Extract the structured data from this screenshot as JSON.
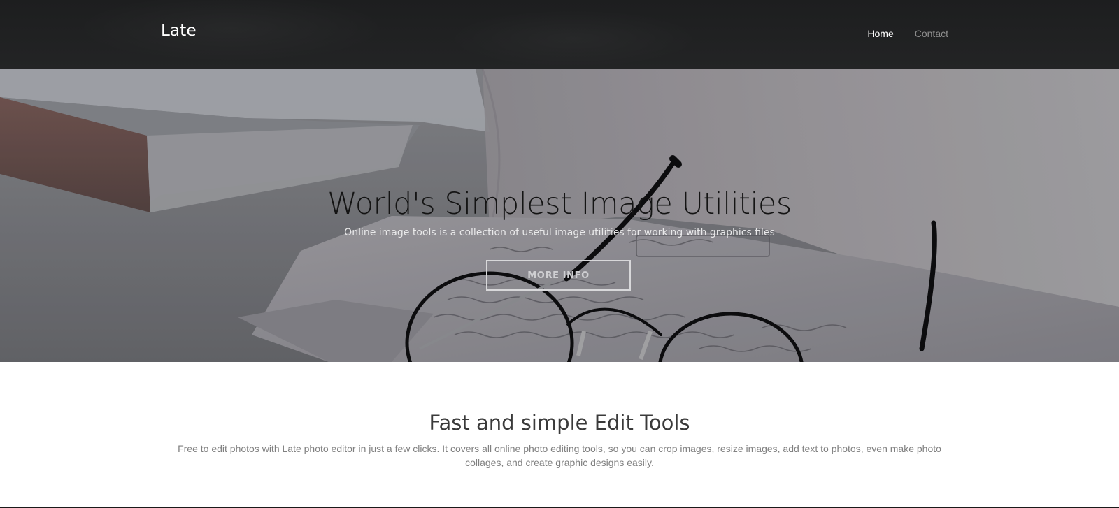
{
  "navbar": {
    "brand": "Late",
    "links": [
      {
        "label": "Home",
        "active": true
      },
      {
        "label": "Contact",
        "active": false
      }
    ]
  },
  "hero": {
    "title": "World's Simplest Image Utilities",
    "subtitle": "Online image tools is a collection of useful image utilities for working with graphics files",
    "button_label": "MORE INFO",
    "background_description_icon": "photo-glasses-notebook"
  },
  "features": {
    "title": "Fast and simple Edit Tools",
    "text": "Free to edit photos with Late photo editor in just a few clicks. It covers all online photo editing tools, so you can crop images, resize images, add text to photos, even make photo collages, and create graphic designs easily."
  },
  "colors": {
    "navbar_bg": "#1f2021",
    "nav_active": "#ffffff",
    "nav_inactive": "#8e8e8e",
    "hero_title": "#141414",
    "section_title": "#3a3a3a",
    "section_text": "#808080"
  }
}
